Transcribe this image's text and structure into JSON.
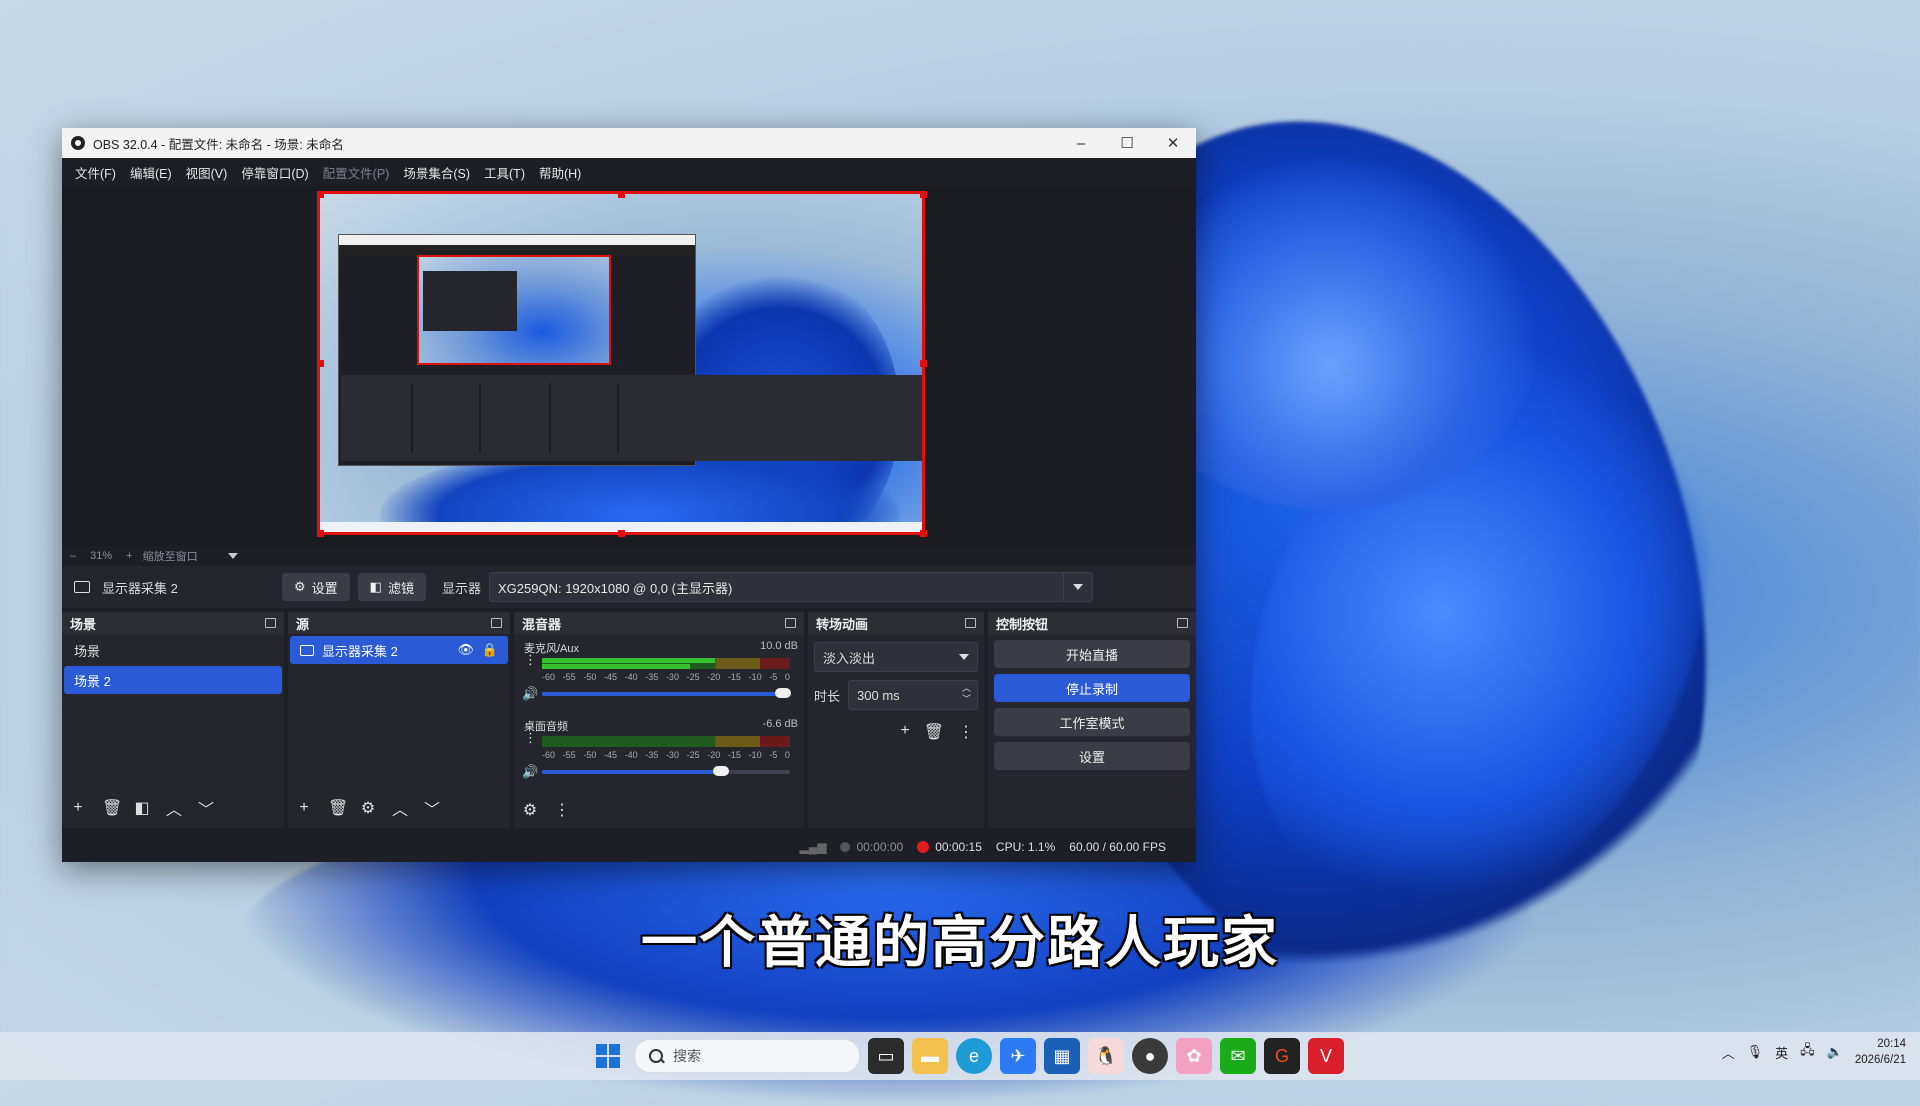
{
  "window": {
    "title": "OBS 32.0.4 - 配置文件: 未命名 - 场景: 未命名",
    "minimize": "–",
    "maximize": "☐",
    "close": "✕"
  },
  "menu": [
    {
      "label": "文件(F)"
    },
    {
      "label": "编辑(E)"
    },
    {
      "label": "视图(V)"
    },
    {
      "label": "停靠窗口(D)"
    },
    {
      "label": "配置文件(P)"
    },
    {
      "label": "场景集合(S)"
    },
    {
      "label": "工具(T)"
    },
    {
      "label": "帮助(H)"
    }
  ],
  "zoom": {
    "minus": "–",
    "value": "31%",
    "plus": "+",
    "fit": "缩放至窗口"
  },
  "source_toolbar": {
    "source_name": "显示器采集 2",
    "settings": "设置",
    "filters": "滤镜",
    "display_label": "显示器",
    "display_value": "XG259QN: 1920x1080 @ 0,0 (主显示器)"
  },
  "scenes": {
    "title": "场景",
    "items": [
      "场景",
      "场景 2"
    ],
    "selected": 1
  },
  "sources": {
    "title": "源",
    "items": [
      "显示器采集 2"
    ]
  },
  "mixer": {
    "title": "混音器",
    "channels": [
      {
        "name": "麦克风/Aux",
        "db": "10.0 dB",
        "level": 0.85,
        "volume": 0.97
      },
      {
        "name": "桌面音频",
        "db": "-6.6 dB",
        "level": 0.0,
        "volume": 0.72
      }
    ],
    "ticks": [
      "-60",
      "-55",
      "-50",
      "-45",
      "-40",
      "-35",
      "-30",
      "-25",
      "-20",
      "-15",
      "-10",
      "-5",
      "0"
    ]
  },
  "transitions": {
    "title": "转场动画",
    "selected": "淡入淡出",
    "duration_label": "时长",
    "duration_value": "300 ms"
  },
  "controls": {
    "title": "控制按钮",
    "start_stream": "开始直播",
    "stop_record": "停止录制",
    "studio_mode": "工作室模式",
    "settings": "设置"
  },
  "status": {
    "stream_time": "00:00:00",
    "record_time": "00:00:15",
    "cpu": "CPU: 1.1%",
    "fps": "60.00 / 60.00 FPS"
  },
  "subtitle": "一个普通的高分路人玩家",
  "taskbar": {
    "search_placeholder": "搜索",
    "lang": "英",
    "time": "20:14",
    "date": "2026/6/21"
  },
  "colors": {
    "accent": "#2a5ad6",
    "record_red": "#e01c1c",
    "canvas_outline": "#e01010"
  }
}
